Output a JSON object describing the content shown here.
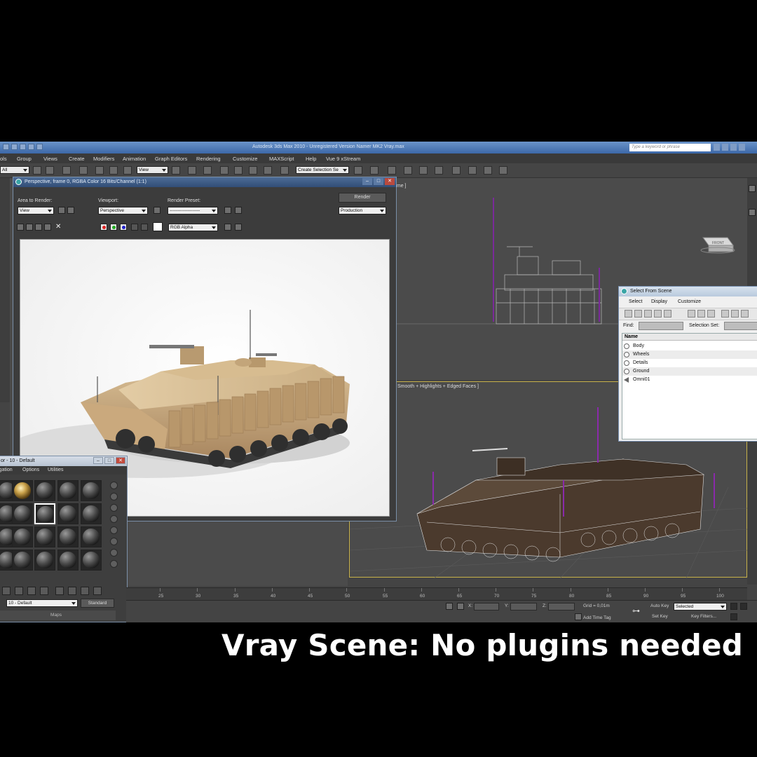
{
  "app": {
    "title": "Autodesk 3ds Max 2010 - Unregistered Version   Namer MK2 Vray.max",
    "search_placeholder": "Type a keyword or phrase",
    "menu": [
      "ols",
      "Group",
      "Views",
      "Create",
      "Modifiers",
      "Animation",
      "Graph Editors",
      "Rendering",
      "Customize",
      "MAXScript",
      "Help",
      "Vue 9 xStream"
    ],
    "toolbar": {
      "filter_value": "All",
      "coord_value": "View",
      "selection_set_value": "Create Selection Se"
    }
  },
  "viewports": {
    "left_label": "",
    "top_right_label": "ame ]",
    "bottom_right_label": "Smooth + Highlights + Edged Faces ]",
    "viewcube_label": "FRONT"
  },
  "render_window": {
    "title": "Perspective, frame 0, RGBA Color 16 Bits/Channel (1:1)",
    "area_to_render_label": "Area to Render:",
    "area_to_render_value": "View",
    "viewport_label": "Viewport:",
    "viewport_value": "Perspective",
    "render_preset_label": "Render Preset:",
    "render_preset_value": "--------------------",
    "render_button": "Render",
    "production_value": "Production",
    "channel_value": "RGB Alpha"
  },
  "material_editor": {
    "title": "or - 10 - Default",
    "menu": [
      "igation",
      "Options",
      "Utilities"
    ],
    "material_name": "10 - Default",
    "material_type": "Standard",
    "maps_label": "Maps"
  },
  "select_from_scene": {
    "title": "Select From Scene",
    "menu": [
      "Select",
      "Display",
      "Customize"
    ],
    "find_label": "Find:",
    "selection_set_label": "Selection Set:",
    "column_header": "Name",
    "items": [
      "Body",
      "Wheels",
      "Details",
      "Ground",
      "Omni01"
    ]
  },
  "timeline": {
    "ticks": [
      "25",
      "30",
      "35",
      "40",
      "45",
      "50",
      "55",
      "60",
      "65",
      "70",
      "75",
      "80",
      "85",
      "90",
      "95",
      "100"
    ]
  },
  "status": {
    "x_label": "X:",
    "y_label": "Y:",
    "z_label": "Z:",
    "grid_label": "Grid = 0,01m",
    "add_time_tag": "Add Time Tag",
    "auto_key": "Auto Key",
    "selected_value": "Selected",
    "set_key": "Set Key",
    "key_filters": "Key Filters..."
  },
  "caption": "Vray Scene: No plugins needed",
  "colors": {
    "accent_titlebar": "#4a75b4",
    "viewport_bg": "#4b4b4b",
    "tank_tan": "#c9a97c"
  }
}
